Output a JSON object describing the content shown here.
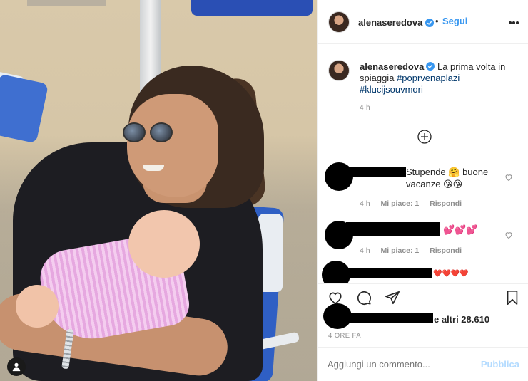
{
  "post": {
    "username": "alenaseredova",
    "follow_label": "Segui",
    "separator": "•",
    "caption_text": "La prima volta in spiaggia",
    "hashtags": [
      "#poprvenaplazi",
      "#klucijsouvmori"
    ],
    "caption_time": "4 h",
    "likes_suffix": "e altri 28.610",
    "post_time": "4 ORE FA"
  },
  "comments": [
    {
      "text": "Stupende 🤗 buone vacanze 😘😘",
      "time": "4 h",
      "likes": "Mi piace: 1",
      "reply": "Rispondi"
    },
    {
      "text": "💕💕💕",
      "time": "4 h",
      "likes": "Mi piace: 1",
      "reply": "Rispondi"
    },
    {
      "text": "❤️❤️❤️❤️"
    }
  ],
  "add_comment": {
    "placeholder": "Aggiungi un commento...",
    "publish_label": "Pubblica"
  },
  "colors": {
    "accent": "#3897f0",
    "hashtag": "#00376b",
    "muted": "#8e8e8e",
    "publish_disabled": "#b3dbff"
  },
  "icons": [
    "user-tag-icon",
    "verified-icon",
    "more-options-icon",
    "load-more-icon",
    "heart-icon",
    "comment-icon",
    "share-icon",
    "save-icon"
  ]
}
